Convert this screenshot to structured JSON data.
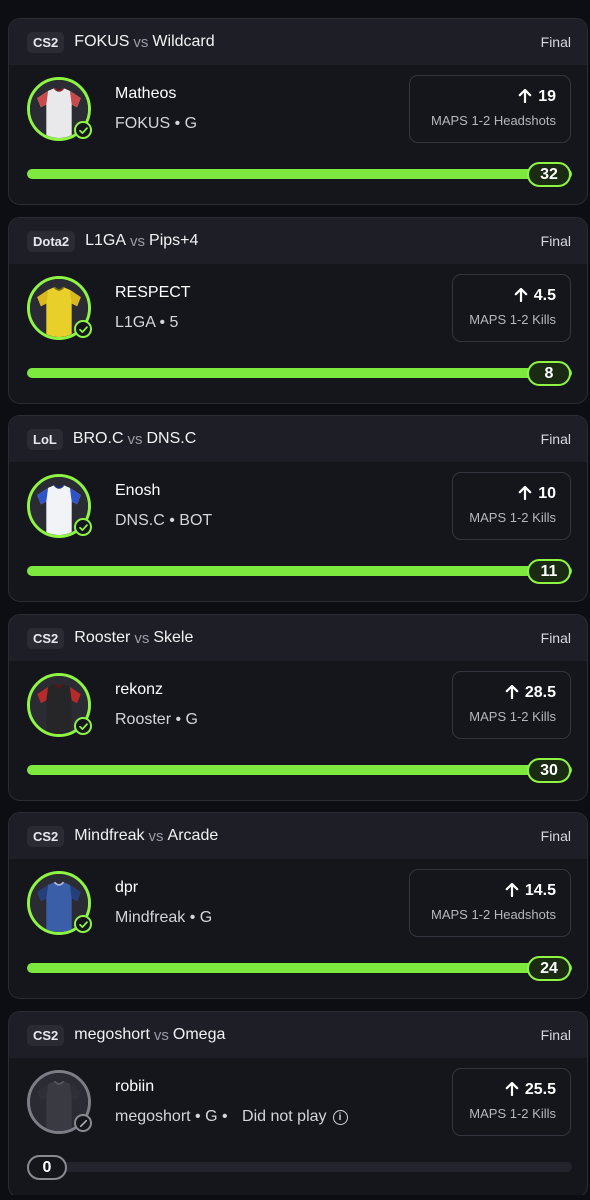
{
  "cards": [
    {
      "game": "CS2",
      "team1": "FOKUS",
      "vs": "vs",
      "team2": "Wildcard",
      "status": "Final",
      "player": "Matheos",
      "meta": "FOKUS • G",
      "line": "19",
      "stat": "MAPS 1-2 Headshots",
      "result": "32",
      "progress": 1.0,
      "jersey": "white-red",
      "played": true
    },
    {
      "game": "Dota2",
      "team1": "L1GA",
      "vs": "vs",
      "team2": "Pips+4",
      "status": "Final",
      "player": "RESPECT",
      "meta": "L1GA • 5",
      "line": "4.5",
      "stat": "MAPS 1-2 Kills",
      "result": "8",
      "progress": 1.0,
      "jersey": "yellow",
      "played": true
    },
    {
      "game": "LoL",
      "team1": "BRO.C",
      "vs": "vs",
      "team2": "DNS.C",
      "status": "Final",
      "player": "Enosh",
      "meta": "DNS.C • BOT",
      "line": "10",
      "stat": "MAPS 1-2 Kills",
      "result": "11",
      "progress": 1.0,
      "jersey": "white-blue",
      "played": true
    },
    {
      "game": "CS2",
      "team1": "Rooster",
      "vs": "vs",
      "team2": "Skele",
      "status": "Final",
      "player": "rekonz",
      "meta": "Rooster • G",
      "line": "28.5",
      "stat": "MAPS 1-2 Kills",
      "result": "30",
      "progress": 1.0,
      "jersey": "black-red",
      "played": true
    },
    {
      "game": "CS2",
      "team1": "Mindfreak",
      "vs": "vs",
      "team2": "Arcade",
      "status": "Final",
      "player": "dpr",
      "meta": "Mindfreak • G",
      "line": "14.5",
      "stat": "MAPS 1-2 Headshots",
      "result": "24",
      "progress": 1.0,
      "jersey": "blue",
      "played": true
    },
    {
      "game": "CS2",
      "team1": "megoshort",
      "vs": "vs",
      "team2": "Omega",
      "status": "Final",
      "player": "robiin",
      "meta": "megoshort • G •",
      "dnp": "Did not play",
      "line": "25.5",
      "stat": "MAPS 1-2 Kills",
      "result": "0",
      "progress": 0.0,
      "jersey": "grey",
      "played": false
    }
  ],
  "colors": {
    "accent": "#7de83d",
    "card_bg": "#15161c",
    "header_bg": "#1e1f26",
    "page_bg": "#0d0e13"
  },
  "icons": [
    "up-arrow-icon",
    "check-circle-icon",
    "blocked-icon",
    "info-icon",
    "jersey-icon"
  ]
}
